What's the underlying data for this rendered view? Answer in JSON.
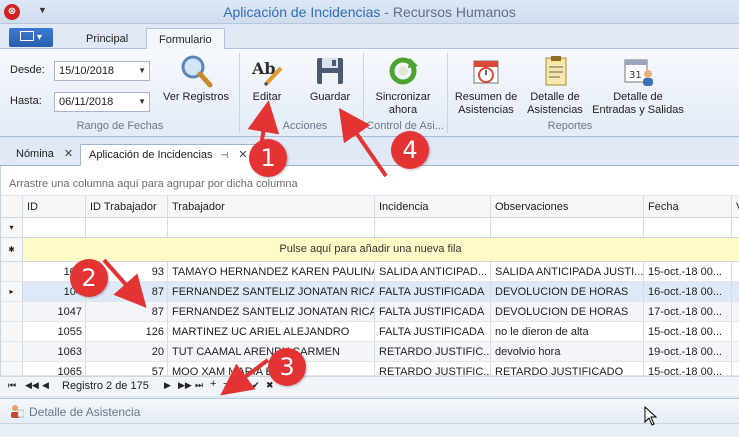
{
  "window": {
    "title_main": "Aplicación de Incidencias",
    "title_sep": " - ",
    "title_sub": "Recursos Humanos"
  },
  "app_menu": {
    "icon": "app-menu-icon"
  },
  "ribbon_tabs": [
    {
      "label": "Principal",
      "active": false
    },
    {
      "label": "Formulario",
      "active": true
    }
  ],
  "ribbon": {
    "date_range": {
      "desde_label": "Desde:",
      "desde_value": "15/10/2018",
      "hasta_label": "Hasta:",
      "hasta_value": "06/11/2018",
      "ver_registros": "Ver Registros",
      "group_label": "Rango de Fechas"
    },
    "acciones": {
      "editar": "Editar",
      "guardar": "Guardar",
      "group_label": "Acciones"
    },
    "control": {
      "sincronizar_line1": "Sincronizar",
      "sincronizar_line2": "ahora",
      "group_label": "Control de Asi..."
    },
    "reportes": {
      "resumen_line1": "Resumen de",
      "resumen_line2": "Asistencias",
      "detalle_line1": "Detalle de",
      "detalle_line2": "Asistencias",
      "entradas_line1": "Detalle de",
      "entradas_line2": "Entradas y Salidas",
      "calendar_day": "31",
      "group_label": "Reportes"
    }
  },
  "doc_tabs": [
    {
      "label": "Nómina",
      "active": false
    },
    {
      "label": "Aplicación de Incidencias",
      "active": true
    }
  ],
  "grid": {
    "group_hint": "Arrastre una columna aquí para agrupar por dicha columna",
    "columns": [
      "ID",
      "ID Trabajador",
      "Trabajador",
      "Incidencia",
      "Observaciones",
      "Fecha",
      "V"
    ],
    "new_row_hint": "Pulse aquí para añadir una nueva fila",
    "rows": [
      {
        "id": "104",
        "id_trabajador": "93",
        "trabajador": "TAMAYO HERNANDEZ KAREN PAULINA",
        "incidencia": "SALIDA ANTICIPAD...",
        "observaciones": "SALIDA ANTICIPADA JUSTI...",
        "fecha": "15-oct.-18 00..."
      },
      {
        "id": "104",
        "id_trabajador": "87",
        "trabajador": "FERNANDEZ SANTELIZ JONATAN RICA...",
        "incidencia": "FALTA JUSTIFICADA",
        "observaciones": "DEVOLUCION DE HORAS",
        "fecha": "16-oct.-18 00..."
      },
      {
        "id": "1047",
        "id_trabajador": "87",
        "trabajador": "FERNANDEZ SANTELIZ JONATAN RICA...",
        "incidencia": "FALTA JUSTIFICADA",
        "observaciones": "DEVOLUCION DE HORAS",
        "fecha": "17-oct.-18 00..."
      },
      {
        "id": "1055",
        "id_trabajador": "126",
        "trabajador": "MARTINEZ  UC ARIEL ALEJANDRO",
        "incidencia": "FALTA JUSTIFICADA",
        "observaciones": "no le dieron de alta",
        "fecha": "15-oct.-18 00..."
      },
      {
        "id": "1063",
        "id_trabajador": "20",
        "trabajador": "TUT CAAMAL ARENDY CARMEN",
        "incidencia": "RETARDO JUSTIFIC...",
        "observaciones": "devolvio hora",
        "fecha": "19-oct.-18 00..."
      },
      {
        "id": "1065",
        "id_trabajador": "57",
        "trabajador": "MOO XAM MARIA EU...",
        "incidencia": "RETARDO JUSTIFIC...",
        "observaciones": "RETARDO JUSTIFICADO",
        "fecha": "15-oct.-18 00..."
      }
    ],
    "selected_row_index": 1
  },
  "navigator": {
    "record_text": "Registro 2 de 175"
  },
  "bottom_panel": {
    "title": "Detalle de Asistencia"
  },
  "annotations": [
    {
      "label": "1"
    },
    {
      "label": "2"
    },
    {
      "label": "3"
    },
    {
      "label": "4"
    }
  ],
  "colors": {
    "badge": "#e33333",
    "title_accent": "#2f6db5",
    "new_row_bg": "#fffac8",
    "selected_row_bg": "#dde9f7"
  }
}
